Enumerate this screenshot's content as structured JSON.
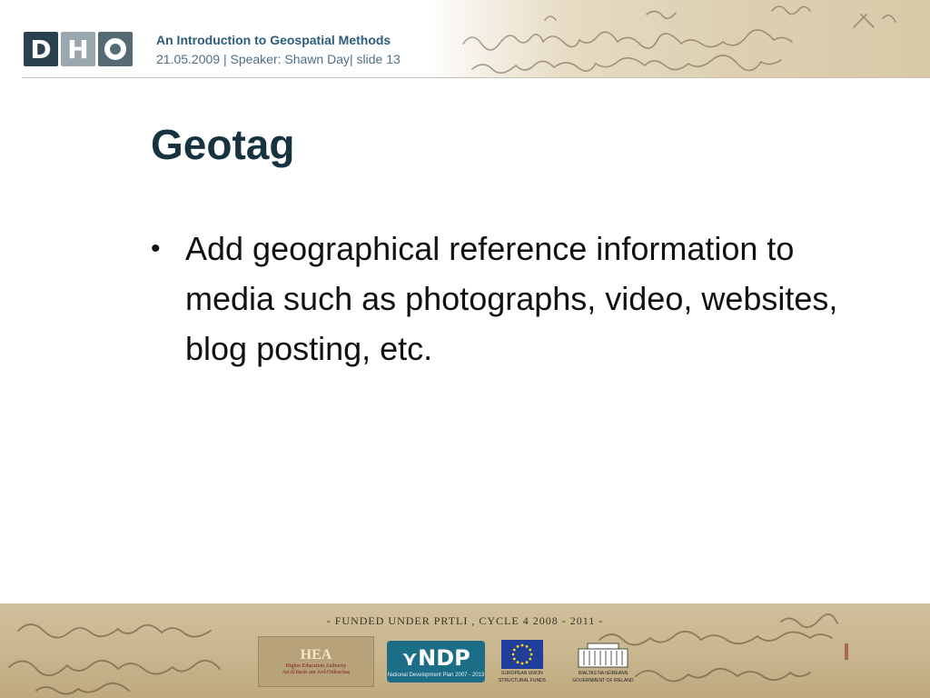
{
  "header": {
    "logo_letters": [
      "D",
      "H",
      "O"
    ],
    "title": "An Introduction to Geospatial Methods",
    "subtitle": "21.05.2009 | Speaker: Shawn Day| slide 13"
  },
  "slide": {
    "title": "Geotag",
    "bullets": [
      "Add geographical reference information to media such as photographs, video, websites, blog posting, etc."
    ]
  },
  "footer": {
    "funding_text": "-  FUNDED UNDER PRTLI , CYCLE 4 2008 - 2011  -",
    "sponsors": {
      "hea": {
        "title": "HEA",
        "line1": "Higher Education Authority",
        "line2": "An tÚdarás um Ard-Oideachas"
      },
      "ndp": {
        "title": "NDP",
        "line": "National Development Plan 2007 - 2013"
      },
      "eu": {
        "line1": "EUROPEAN UNION",
        "line2": "STRUCTURAL FUNDS"
      },
      "govt": {
        "line1": "RIALTAS NA hÉIREANN",
        "line2": "GOVERNMENT OF IRELAND"
      }
    }
  },
  "colors": {
    "title": "#17333f",
    "header_title": "#2c5d7c",
    "logo_dark": "#2a4150",
    "logo_light": "#9aa7ae"
  }
}
